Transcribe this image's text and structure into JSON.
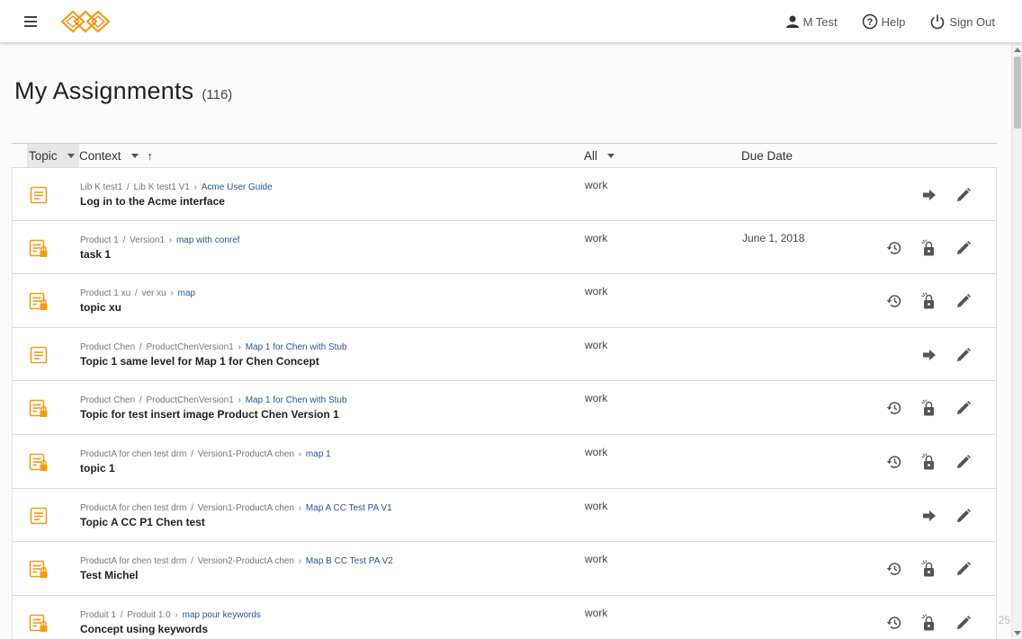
{
  "header": {
    "user_label": "M Test",
    "help_label": "Help",
    "signout_label": "Sign Out"
  },
  "page": {
    "title": "My Assignments",
    "count": "(116)"
  },
  "table_header": {
    "topic": "Topic",
    "context": "Context",
    "sort_arrow": "↑",
    "filter": "All",
    "due": "Due Date"
  },
  "rows": [
    {
      "product": "Lib K test1",
      "version": "Lib K test1 V1",
      "map": "Acme User Guide",
      "title": "Log in to the Acme interface",
      "status": "work",
      "due": "",
      "icon": "topic-icon",
      "actions": [
        "open-arrow-icon",
        "edit-pencil-icon"
      ]
    },
    {
      "product": "Product 1",
      "version": "Version1",
      "map": "map with conref",
      "title": "task 1",
      "status": "work",
      "due": "June 1, 2018",
      "icon": "locked-topic-icon",
      "actions": [
        "history-icon",
        "unlock-icon",
        "edit-pencil-icon"
      ]
    },
    {
      "product": "Product 1 xu",
      "version": "ver xu",
      "map": "map",
      "title": "topic xu",
      "status": "work",
      "due": "",
      "icon": "locked-topic-icon",
      "actions": [
        "history-icon",
        "unlock-icon",
        "edit-pencil-icon"
      ]
    },
    {
      "product": "Product Chen",
      "version": "ProductChenVersion1",
      "map": "Map 1 for Chen with Stub",
      "title": "Topic 1 same level for Map 1 for Chen Concept",
      "status": "work",
      "due": "",
      "icon": "topic-icon",
      "actions": [
        "open-arrow-icon",
        "edit-pencil-icon"
      ]
    },
    {
      "product": "Product Chen",
      "version": "ProductChenVersion1",
      "map": "Map 1 for Chen with Stub",
      "title": "Topic for test insert image Product Chen Version 1",
      "status": "work",
      "due": "",
      "icon": "locked-topic-icon",
      "actions": [
        "history-icon",
        "unlock-icon",
        "edit-pencil-icon"
      ]
    },
    {
      "product": "ProductA for chen test drm",
      "version": "Version1-ProductA chen",
      "map": "map 1",
      "title": "topic 1",
      "status": "work",
      "due": "",
      "icon": "locked-topic-icon",
      "actions": [
        "history-icon",
        "unlock-icon",
        "edit-pencil-icon"
      ]
    },
    {
      "product": "ProductA for chen test drm",
      "version": "Version1-ProductA chen",
      "map": "Map A CC Test PA V1",
      "title": "Topic A CC P1 Chen test",
      "status": "work",
      "due": "",
      "icon": "topic-icon",
      "actions": [
        "open-arrow-icon",
        "edit-pencil-icon"
      ]
    },
    {
      "product": "ProductA for chen test drm",
      "version": "Version2-ProductA chen",
      "map": "Map B CC Test PA V2",
      "title": "Test Michel",
      "status": "work",
      "due": "",
      "icon": "locked-topic-icon",
      "actions": [
        "history-icon",
        "unlock-icon",
        "edit-pencil-icon"
      ]
    },
    {
      "product": "Produit 1",
      "version": "Produit 1.0",
      "map": "map pour keywords",
      "title": "Concept using keywords",
      "status": "work",
      "due": "",
      "icon": "locked-topic-icon",
      "actions": [
        "history-icon",
        "unlock-icon",
        "edit-pencil-icon"
      ]
    }
  ],
  "corner_text": "25",
  "colors": {
    "accent": "#f39c12",
    "link": "#27578f",
    "icon_gray": "#555555"
  }
}
